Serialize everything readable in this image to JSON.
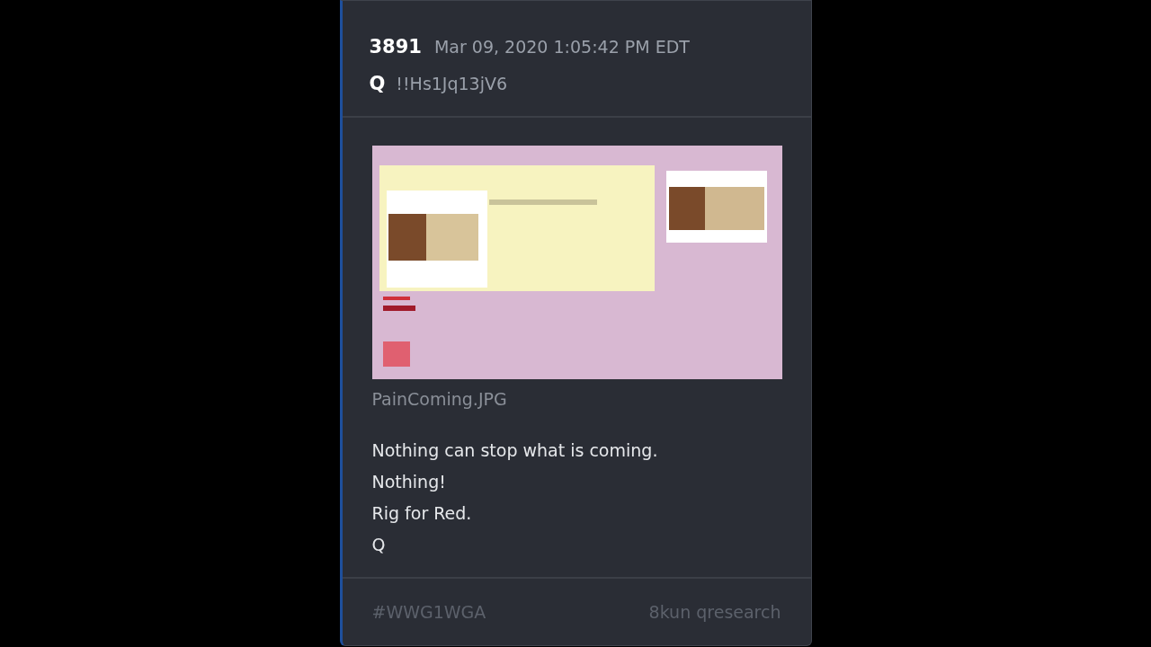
{
  "post": {
    "number": "3891",
    "timestamp": "Mar 09, 2020 1:05:42 PM EDT",
    "author": "Q",
    "tripcode": "!!Hs1Jq13jV6"
  },
  "attachment": {
    "kind": "picture",
    "filename": "PainComing.JPG"
  },
  "message": [
    "Nothing can stop what is coming.",
    "Nothing!",
    "Rig for Red.",
    "Q"
  ],
  "footer": {
    "hashtag": "#WWG1WGA",
    "source": "8kun qresearch"
  }
}
